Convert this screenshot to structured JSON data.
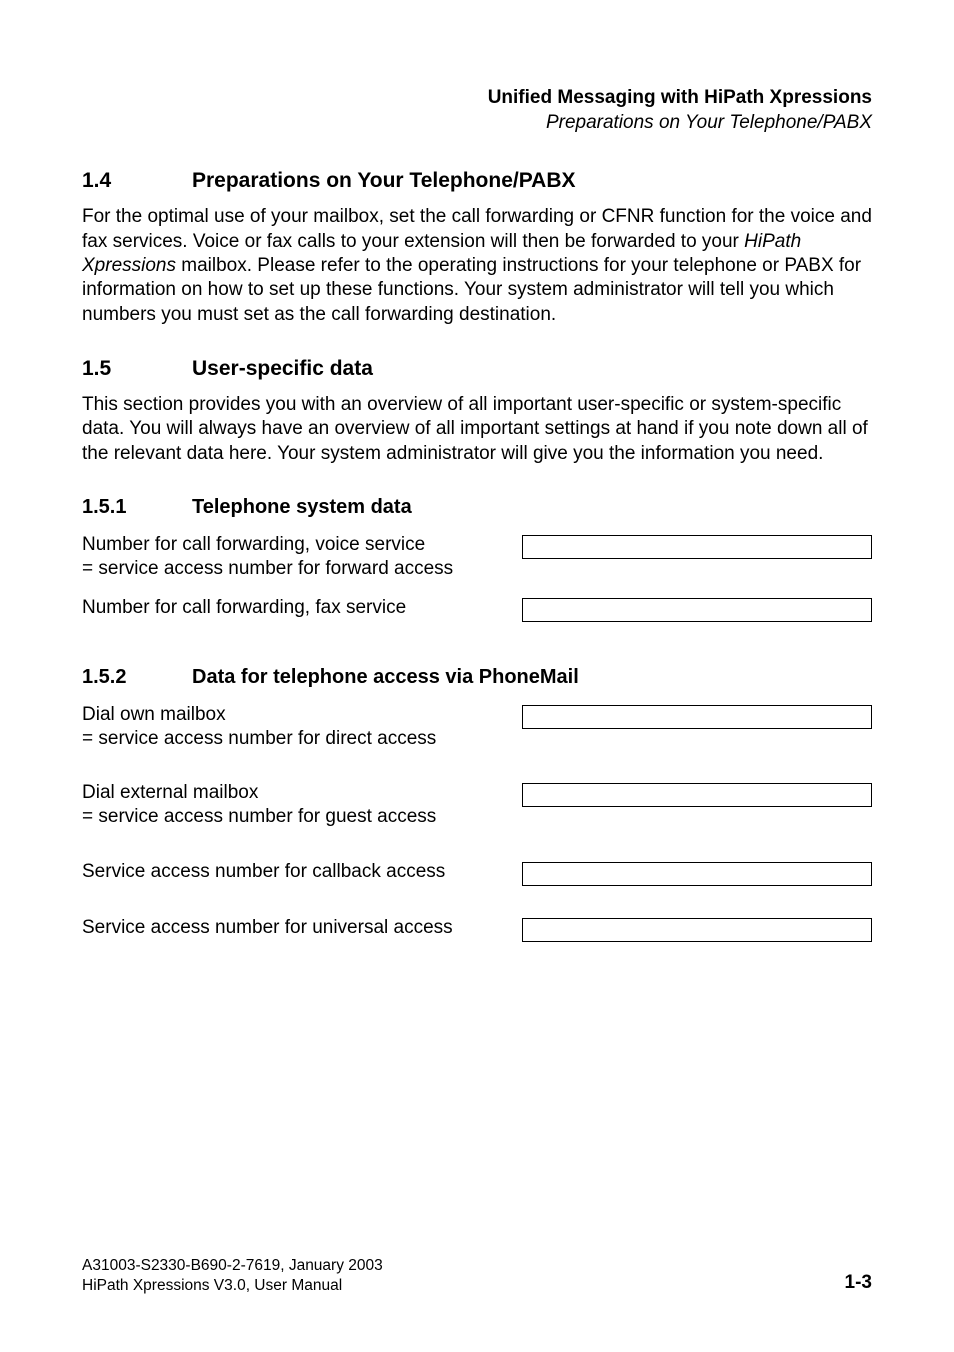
{
  "header": {
    "title": "Unified Messaging with HiPath Xpressions",
    "subtitle": "Preparations on Your Telephone/PABX"
  },
  "sections": {
    "s14": {
      "num": "1.4",
      "title": "Preparations on Your Telephone/PABX",
      "para_a": "For the optimal use of your mailbox, set the call forwarding or CFNR function for the voice and fax services. Voice or fax calls to your extension will then be forwarded to your ",
      "para_italic": "HiPath Xpressions",
      "para_b": " mailbox. Please refer to the operating instructions for your telephone or PABX for information on how to set up these functions. Your system administrator will tell you which numbers you must set as the call forwarding destination."
    },
    "s15": {
      "num": "1.5",
      "title": "User-specific data",
      "para": "This section provides you with an overview of all important user-specific or system-specific data. You will always have an overview of all important settings at hand if you note down all of the relevant data here. Your system administrator will give you the information you need."
    },
    "s151": {
      "num": "1.5.1",
      "title": "Telephone system data",
      "fields": {
        "voice": {
          "line1": "Number for call forwarding, voice service",
          "line2": "= service access number for forward access",
          "value": ""
        },
        "fax": {
          "line1": "Number for call forwarding, fax service",
          "value": ""
        }
      }
    },
    "s152": {
      "num": "1.5.2",
      "title": "Data for telephone access via PhoneMail",
      "fields": {
        "own": {
          "line1": "Dial own mailbox",
          "line2": "= service access number for direct access",
          "value": ""
        },
        "ext": {
          "line1": "Dial external mailbox",
          "line2": "= service access number for guest access",
          "value": ""
        },
        "callback": {
          "line1": "Service access number for callback access",
          "value": ""
        },
        "universal": {
          "line1": "Service access number for universal access",
          "value": ""
        }
      }
    }
  },
  "footer": {
    "line1": "A31003-S2330-B690-2-7619, January 2003",
    "line2": "HiPath Xpressions V3.0, User Manual",
    "page": "1-3"
  }
}
